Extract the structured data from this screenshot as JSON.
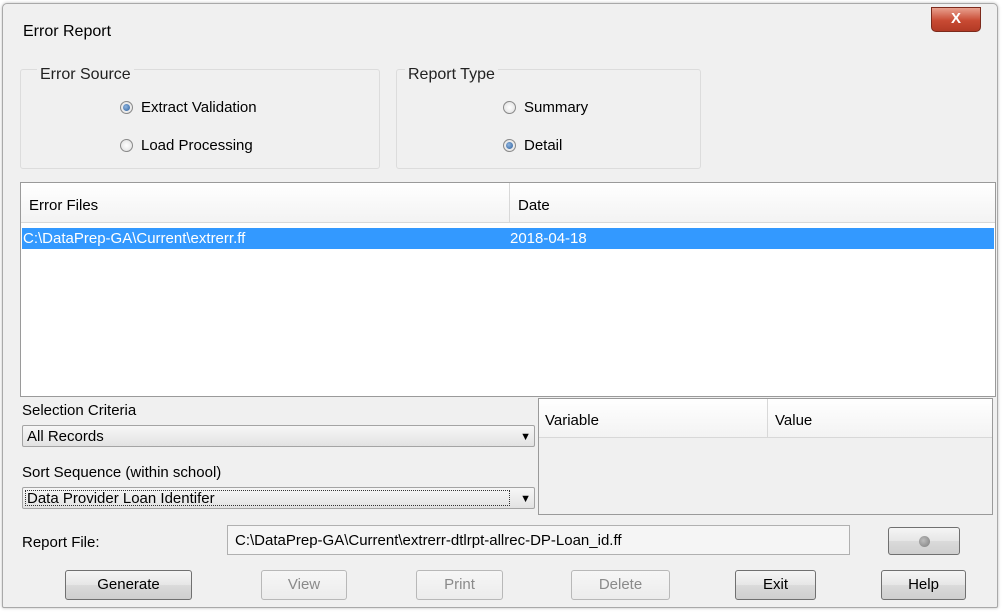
{
  "window": {
    "title": "Error Report",
    "close_glyph": "X"
  },
  "error_source": {
    "label": "Error Source",
    "options": [
      {
        "label": "Extract Validation",
        "checked": true
      },
      {
        "label": "Load Processing",
        "checked": false
      }
    ]
  },
  "report_type": {
    "label": "Report Type",
    "options": [
      {
        "label": "Summary",
        "checked": false
      },
      {
        "label": "Detail",
        "checked": true
      }
    ]
  },
  "files": {
    "headers": [
      "Error Files",
      "Date"
    ],
    "rows": [
      {
        "file": "C:\\DataPrep-GA\\Current\\extrerr.ff",
        "date": "2018-04-18",
        "selected": true
      }
    ]
  },
  "selection_criteria": {
    "label": "Selection Criteria",
    "value": "All Records"
  },
  "sort_sequence": {
    "label": "Sort Sequence (within school)",
    "value": "Data Provider Loan Identifer"
  },
  "variables": {
    "headers": [
      "Variable",
      "Value"
    ]
  },
  "report_file": {
    "label": "Report File:",
    "value": "C:\\DataPrep-GA\\Current\\extrerr-dtlrpt-allrec-DP-Loan_id.ff"
  },
  "buttons": {
    "generate": "Generate",
    "view": "View",
    "print": "Print",
    "delete": "Delete",
    "exit": "Exit",
    "help": "Help"
  },
  "colors": {
    "selection": "#3399ff",
    "close": "#c84a33"
  },
  "icons": {
    "browse": "dot-icon",
    "dropdown": "chevron-down-icon",
    "radio": "radio-icon"
  }
}
